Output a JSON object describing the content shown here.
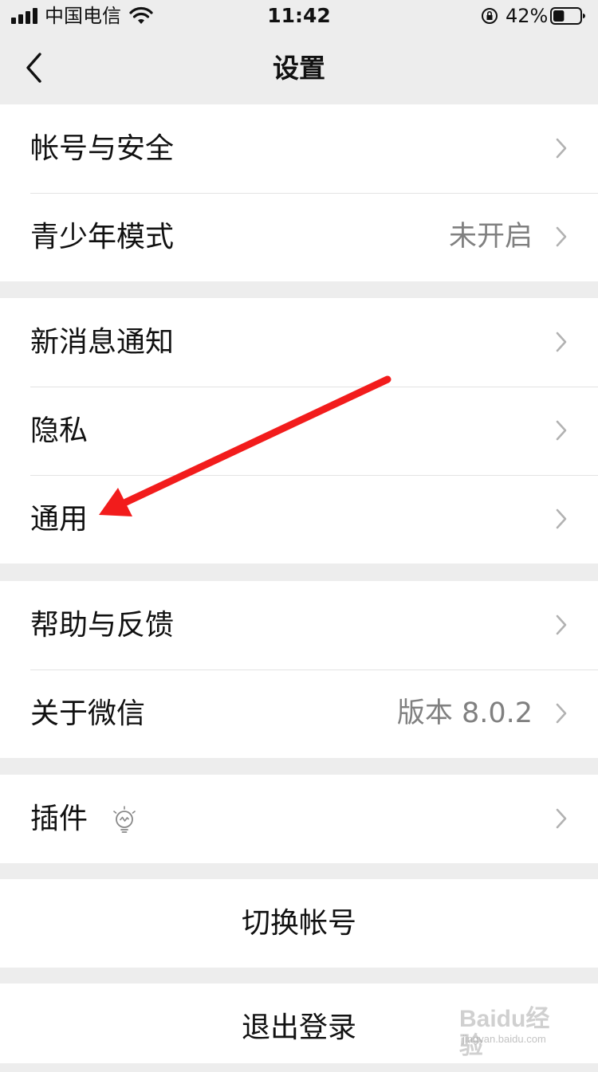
{
  "status_bar": {
    "carrier": "中国电信",
    "time": "11:42",
    "battery_percent": "42%",
    "battery_level": 0.42,
    "icons": [
      "signal-icon",
      "wifi-icon",
      "rotation-lock-icon",
      "battery-icon"
    ]
  },
  "nav": {
    "title": "设置",
    "back_icon": "chevron-left-icon"
  },
  "groups": [
    {
      "items": [
        {
          "label": "帐号与安全",
          "value": ""
        },
        {
          "label": "青少年模式",
          "value": "未开启"
        }
      ]
    },
    {
      "items": [
        {
          "label": "新消息通知",
          "value": ""
        },
        {
          "label": "隐私",
          "value": ""
        },
        {
          "label": "通用",
          "value": ""
        }
      ]
    },
    {
      "items": [
        {
          "label": "帮助与反馈",
          "value": ""
        },
        {
          "label": "关于微信",
          "value": "版本 8.0.2"
        }
      ]
    },
    {
      "items": [
        {
          "label": "插件",
          "value": "",
          "icon": "lightbulb-icon"
        }
      ]
    }
  ],
  "actions": {
    "switch_account": "切换帐号",
    "logout": "退出登录"
  },
  "annotation": {
    "icon": "red-arrow-icon",
    "color": "#f21c1c"
  },
  "watermark": {
    "text": "Baidu经验",
    "sub": "jingyan.baidu.com"
  },
  "colors": {
    "background": "#ededed",
    "card": "#ffffff",
    "text": "#111111",
    "secondary_text": "#808080",
    "chevron": "#b2b2b2"
  }
}
